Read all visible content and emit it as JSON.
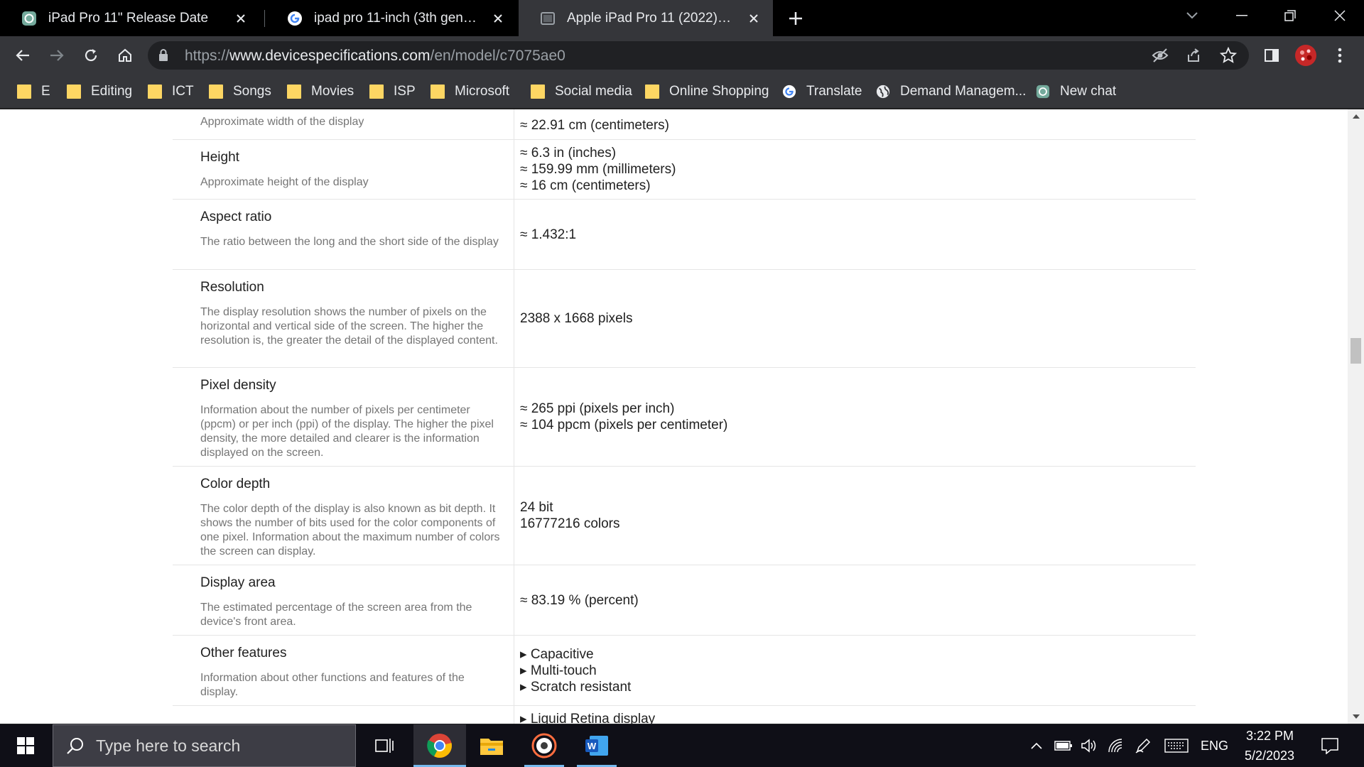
{
  "tabs": [
    {
      "title": "iPad Pro 11\" Release Date",
      "icon": "chatgpt-icon"
    },
    {
      "title": "ipad pro 11-inch (3th generation)",
      "icon": "google-icon"
    },
    {
      "title": "Apple iPad Pro 11 (2022) - Specifications",
      "icon": "site-icon",
      "active": true
    }
  ],
  "address": {
    "scheme": "https://",
    "host": "www.devicespecifications.com",
    "path": "/en/model/c7075ae0"
  },
  "bookmarks": [
    {
      "label": "E",
      "icon": "folder-icon"
    },
    {
      "label": "Editing",
      "icon": "folder-icon"
    },
    {
      "label": "ICT",
      "icon": "folder-icon"
    },
    {
      "label": "Songs",
      "icon": "folder-icon"
    },
    {
      "label": "Movies",
      "icon": "folder-icon"
    },
    {
      "label": "ISP",
      "icon": "folder-icon"
    },
    {
      "label": "Microsoft",
      "icon": "folder-icon"
    },
    {
      "label": "Social media",
      "icon": "folder-icon"
    },
    {
      "label": "Online Shopping",
      "icon": "folder-icon"
    },
    {
      "label": "Translate",
      "icon": "google-icon"
    },
    {
      "label": "Demand Managem...",
      "icon": "globe-icon"
    },
    {
      "label": "New chat",
      "icon": "chatgpt-icon"
    }
  ],
  "spec_rows": [
    {
      "name": "",
      "desc": "Approximate width of the display",
      "values": [
        "≈ 22.91 cm (centimeters)"
      ]
    },
    {
      "name": "Height",
      "desc": "Approximate height of the display",
      "values": [
        "≈ 6.3 in (inches)",
        "≈ 159.99 mm (millimeters)",
        "≈ 16 cm (centimeters)"
      ]
    },
    {
      "name": "Aspect ratio",
      "desc": "The ratio between the long and the short side of the display",
      "values": [
        "≈ 1.432:1"
      ]
    },
    {
      "name": "Resolution",
      "desc": "The display resolution shows the number of pixels on the horizontal and vertical side of the screen. The higher the resolution is, the greater the detail of the displayed content.",
      "values": [
        "2388 x 1668 pixels"
      ]
    },
    {
      "name": "Pixel density",
      "desc": "Information about the number of pixels per centimeter (ppcm) or per inch (ppi) of the display. The higher the pixel density, the more detailed and clearer is the information displayed on the screen.",
      "values": [
        "≈ 265 ppi (pixels per inch)",
        "≈ 104 ppcm (pixels per centimeter)"
      ]
    },
    {
      "name": "Color depth",
      "desc": "The color depth of the display is also known as bit depth. It shows the number of bits used for the color components of one pixel. Information about the maximum number of colors the screen can display.",
      "values": [
        "24 bit",
        "16777216 colors"
      ]
    },
    {
      "name": "Display area",
      "desc": "The estimated percentage of the screen area from the device's front area.",
      "values": [
        "≈ 83.19 % (percent)"
      ]
    },
    {
      "name": "Other features",
      "desc": "Information about other functions and features of the display.",
      "values": [
        "▸ Capacitive",
        "▸ Multi-touch",
        "▸ Scratch resistant"
      ]
    },
    {
      "name": "",
      "desc": "",
      "values": [
        "▸ Liquid Retina display"
      ]
    }
  ],
  "taskbar": {
    "search_placeholder": "Type here to search",
    "language": "ENG",
    "time": "3:22 PM",
    "date": "5/2/2023"
  }
}
